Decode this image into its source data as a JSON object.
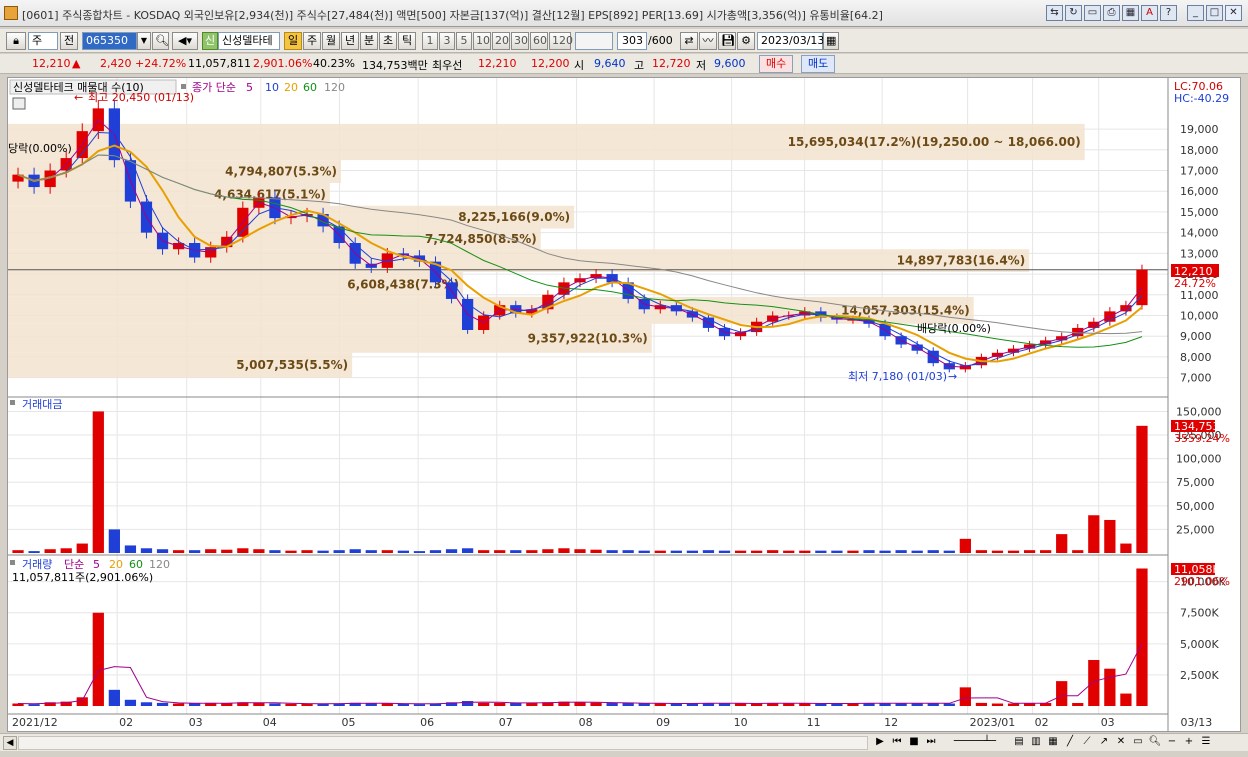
{
  "window": {
    "title": "[0601] 주식종합차트 - KOSDAQ 외국인보유[2,934(천)] 주식수[27,484(천)] 액면[500] 자본금[137(억)] 결산[12월] EPS[892] PER[13.69] 시가총액[3,356(억)] 유통비율[64.2]"
  },
  "toolbar": {
    "type_select": "주",
    "prev_label": "전",
    "code_value": "065350",
    "stock_name": "신성델타테",
    "new_label": "신",
    "period_tabs": [
      "일",
      "주",
      "월",
      "년",
      "분",
      "초",
      "틱"
    ],
    "period_selected": "일",
    "interval_buttons": [
      "1",
      "3",
      "5",
      "10",
      "20",
      "30",
      "60",
      "120"
    ],
    "count_value": "303",
    "count_total": "/600",
    "date_value": "2023/03/13"
  },
  "quote": {
    "price": "12,210",
    "up_arrow": "▲",
    "change": "2,420",
    "change_pct": "+24.72%",
    "volume": "11,057,811",
    "vol_ratio": "2,901.06%",
    "turnover": "40.23%",
    "amount": "134,753백만",
    "best_ask_label": "최우선",
    "best_ask": "12,210",
    "best_bid": "12,200",
    "open_label": "시",
    "open": "9,640",
    "high_label": "고",
    "high": "12,720",
    "low_label": "저",
    "low": "9,600",
    "buy_label": "매수",
    "sell_label": "매도"
  },
  "price_panel": {
    "legend_title": "신성델타테크 매물대 수(10)",
    "legend_ma": "종가 단순",
    "ma_periods": [
      "5",
      "10",
      "20",
      "60",
      "120"
    ],
    "lc": "LC:70.06",
    "hc": "HC:-40.29",
    "high_note": "최고 20,450 (01/13)",
    "low_note": "최저 7,180 (01/03)",
    "drop_note_left": "당락(0.00%)",
    "drop_note_right": "배당락(0.00%)",
    "current_price": "12,210",
    "current_pct": "24.72%",
    "y_ticks": [
      "19,000",
      "18,000",
      "17,000",
      "16,000",
      "15,000",
      "14,000",
      "13,000",
      "12,000",
      "11,000",
      "10,000",
      "9,000",
      "8,000",
      "7,000"
    ],
    "volume_profile": [
      {
        "label": "5,007,535(5.5%)"
      },
      {
        "label": "9,357,922(10.3%)"
      },
      {
        "label": "14,057,303(15.4%)"
      },
      {
        "label": "6,608,438(7.3%)"
      },
      {
        "label": "14,897,783(16.4%)"
      },
      {
        "label": "7,724,850(8.5%)"
      },
      {
        "label": "8,225,166(9.0%)"
      },
      {
        "label": "4,634,617(5.1%)"
      },
      {
        "label": "4,794,807(5.3%)"
      },
      {
        "label": "15,695,034(17.2%)(19,250.00 ~ 18,066.00)"
      }
    ]
  },
  "amount_panel": {
    "title": "거래대금",
    "current": "134,753",
    "current_pct": "3559.24%",
    "y_ticks": [
      "150,000",
      "125,000",
      "100,000",
      "75,000",
      "50,000",
      "25,000"
    ]
  },
  "volume_panel": {
    "title": "거래량",
    "legend_ma": "단순",
    "ma_periods": [
      "5",
      "20",
      "60",
      "120"
    ],
    "summary": "11,057,811주(2,901.06%)",
    "current": "11,058K",
    "current_pct": "2901.06%",
    "y_ticks": [
      "10,000K",
      "7,500K",
      "5,000K",
      "2,500K"
    ]
  },
  "x_axis": {
    "labels": [
      "2021/12",
      "02",
      "03",
      "04",
      "05",
      "06",
      "07",
      "08",
      "09",
      "10",
      "11",
      "12",
      "2023/01",
      "02",
      "03",
      "03/13"
    ]
  },
  "chart_data": {
    "type": "candlestick",
    "series": [
      {
        "name": "종가",
        "values": [
          16800,
          16200,
          17000,
          17600,
          18900,
          20000,
          17500,
          15500,
          14000,
          13200,
          13500,
          12800,
          13300,
          13800,
          15200,
          15700,
          14700,
          14800,
          14900,
          14300,
          13500,
          12500,
          12300,
          13000,
          12900,
          12600,
          11600,
          10800,
          9300,
          10000,
          10500,
          10100,
          10300,
          11000,
          11600,
          11800,
          12000,
          11600,
          10800,
          10300,
          10500,
          10200,
          9900,
          9400,
          9000,
          9200,
          9700,
          10000,
          10000,
          10200,
          9900,
          9800,
          9800,
          9600,
          9000,
          8600,
          8300,
          7700,
          7400,
          7600,
          8000,
          8200,
          8400,
          8600,
          8800,
          9000,
          9400,
          9700,
          10200,
          10500,
          12210
        ]
      },
      {
        "name": "거래대금",
        "values": [
          3000,
          2000,
          4000,
          5000,
          10000,
          150000,
          25000,
          8000,
          5000,
          4000,
          3000,
          3000,
          4000,
          3500,
          5000,
          4000,
          3000,
          2500,
          3000,
          2500,
          3000,
          4000,
          3000,
          3000,
          2500,
          2000,
          3000,
          4000,
          5000,
          3000,
          3000,
          3000,
          3000,
          4000,
          5000,
          4000,
          3500,
          3000,
          3000,
          2500,
          2500,
          2500,
          2500,
          3000,
          2500,
          2500,
          2500,
          3000,
          2500,
          2500,
          2500,
          2500,
          2500,
          3000,
          2500,
          3000,
          2500,
          3000,
          2500,
          15000,
          3000,
          2500,
          2500,
          3000,
          3000,
          20000,
          3000,
          40000,
          35000,
          10000,
          134753
        ]
      },
      {
        "name": "거래량",
        "values": [
          200,
          150,
          300,
          350,
          700,
          7500,
          1300,
          500,
          300,
          250,
          200,
          200,
          250,
          220,
          300,
          260,
          200,
          180,
          200,
          170,
          200,
          260,
          200,
          200,
          180,
          150,
          200,
          300,
          400,
          250,
          250,
          250,
          250,
          300,
          350,
          300,
          270,
          240,
          240,
          200,
          200,
          200,
          200,
          240,
          200,
          200,
          200,
          240,
          200,
          200,
          200,
          200,
          200,
          240,
          200,
          240,
          200,
          240,
          200,
          1500,
          250,
          200,
          200,
          240,
          240,
          2000,
          240,
          3700,
          3000,
          1000,
          11058
        ]
      }
    ],
    "price_ylim": [
      6500,
      20500
    ],
    "amount_ylim": [
      0,
      160000
    ],
    "volume_ylim": [
      0,
      11500
    ]
  }
}
